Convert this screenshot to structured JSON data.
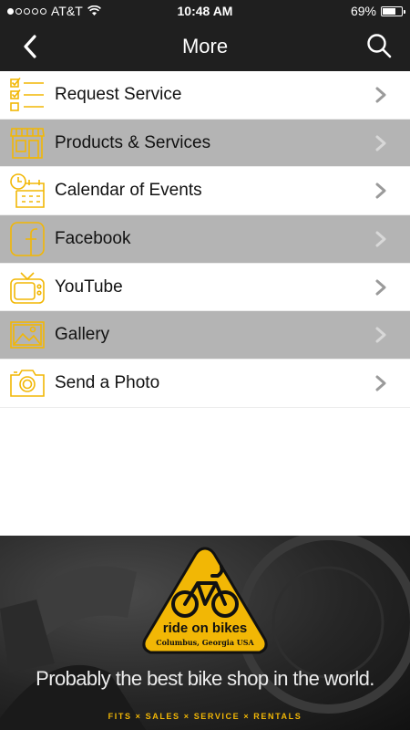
{
  "status": {
    "carrier": "AT&T",
    "time": "10:48 AM",
    "battery": "69%",
    "battery_level": 0.69,
    "signal_bars": 1
  },
  "nav": {
    "title": "More"
  },
  "menu": {
    "items": [
      {
        "label": "Request Service",
        "icon": "checklist-icon"
      },
      {
        "label": "Products & Services",
        "icon": "storefront-icon"
      },
      {
        "label": "Calendar of Events",
        "icon": "calendar-clock-icon"
      },
      {
        "label": "Facebook",
        "icon": "facebook-icon"
      },
      {
        "label": "YouTube",
        "icon": "tv-icon"
      },
      {
        "label": "Gallery",
        "icon": "picture-icon"
      },
      {
        "label": "Send a Photo",
        "icon": "camera-icon"
      }
    ]
  },
  "banner": {
    "logo_title": "ride on bikes",
    "logo_subtitle": "Columbus, Georgia USA",
    "tagline": "Probably the best bike shop in the world.",
    "services": "FITS × SALES × SERVICE × RENTALS"
  },
  "colors": {
    "accent": "#F2B705",
    "bar": "#1F1F1F",
    "alt_row": "#B4B4B4"
  }
}
